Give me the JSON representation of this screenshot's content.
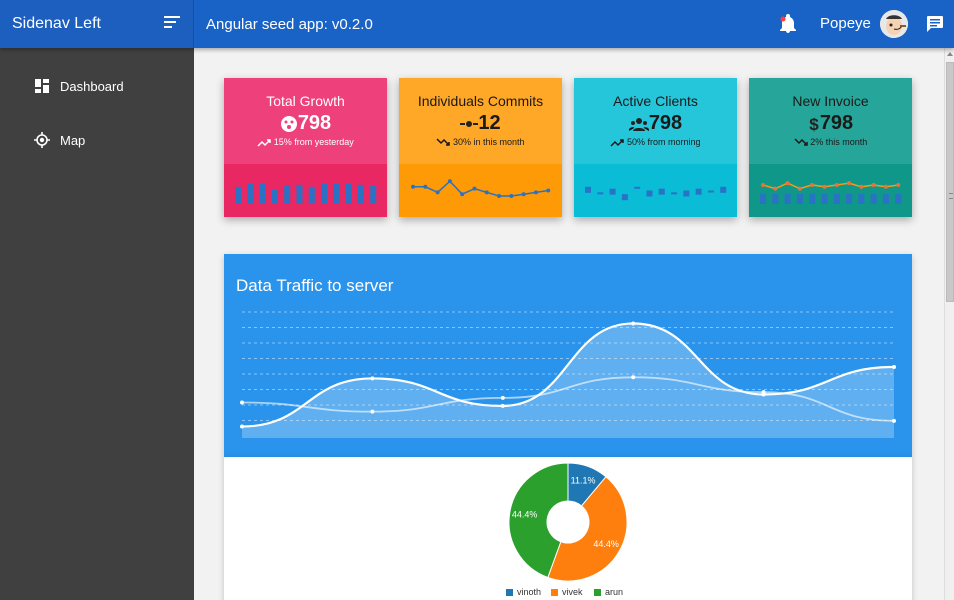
{
  "header": {
    "sidenav_title": "Sidenav Left",
    "app_title": "Angular seed app: v0.2.0",
    "user_name": "Popeye",
    "menu_icon": "sort-menu-icon",
    "notification_icon": "bell-icon",
    "chat_icon": "chat-icon"
  },
  "sidebar": {
    "items": [
      {
        "label": "Dashboard",
        "icon": "dashboard-icon"
      },
      {
        "label": "Map",
        "icon": "gps-icon"
      }
    ]
  },
  "cards": [
    {
      "title": "Total Growth",
      "value": "798",
      "trend": "15% from yesterday",
      "trend_dir": "up",
      "top_color": "#ee407a",
      "bottom_color": "#e92763",
      "text_dark": false,
      "icon": "face-icon",
      "spark_type": "bar",
      "spark": [
        0.45,
        0.3,
        0.3,
        0.6,
        0.4,
        0.35,
        0.45,
        0.3,
        0.3,
        0.3,
        0.35,
        0.4
      ]
    },
    {
      "title": "Individuals Commits",
      "value": "12",
      "trend": "30% in this month",
      "trend_dir": "down",
      "top_color": "#ffa726",
      "bottom_color": "#ff9a07",
      "text_dark": true,
      "icon": "commit-icon",
      "spark_type": "line",
      "spark": [
        0.4,
        0.4,
        0.55,
        0.25,
        0.6,
        0.45,
        0.55,
        0.65,
        0.65,
        0.6,
        0.55,
        0.5
      ]
    },
    {
      "title": "Active Clients",
      "value": "798",
      "trend": "50% from morning",
      "trend_dir": "up",
      "top_color": "#26c6da",
      "bottom_color": "#0abcd6",
      "text_dark": true,
      "icon": "group-icon",
      "spark_type": "dash",
      "spark": [
        0.4,
        0.55,
        0.45,
        0.6,
        0.4,
        0.5,
        0.45,
        0.55,
        0.5,
        0.45,
        0.5,
        0.4
      ]
    },
    {
      "title": "New Invoice",
      "value": "798",
      "trend": "2% this month",
      "trend_dir": "down",
      "top_color": "#26a69a",
      "bottom_color": "#0f978a",
      "text_dark": true,
      "icon": "dollar-icon",
      "spark_type": "combo",
      "spark": [
        0.35,
        0.45,
        0.3,
        0.45,
        0.35,
        0.4,
        0.35,
        0.3,
        0.4,
        0.35,
        0.4,
        0.35
      ]
    }
  ],
  "traffic": {
    "title": "Data Traffic to server"
  },
  "colors": {
    "primary": "#1a63c6",
    "sidebar": "#404040",
    "traffic": "#2a94ec",
    "pie_blue": "#1f77b4",
    "pie_orange": "#ff7f0e",
    "pie_green": "#2ca02c"
  },
  "chart_data": [
    {
      "type": "area",
      "title": "Data Traffic to server",
      "series": [
        {
          "values": [
            10,
            52,
            28,
            100,
            38,
            62
          ]
        },
        {
          "values": [
            31,
            23,
            35,
            53,
            40,
            15
          ]
        }
      ],
      "ylim": [
        0,
        110
      ],
      "grid": true
    },
    {
      "type": "pie",
      "labels": [
        "vinoth",
        "vivek",
        "arun"
      ],
      "values": [
        11.1,
        44.4,
        44.4
      ],
      "value_labels": [
        "11.1%",
        "44.4%",
        "44.4%"
      ],
      "legend": "bottom",
      "donut": true
    }
  ]
}
